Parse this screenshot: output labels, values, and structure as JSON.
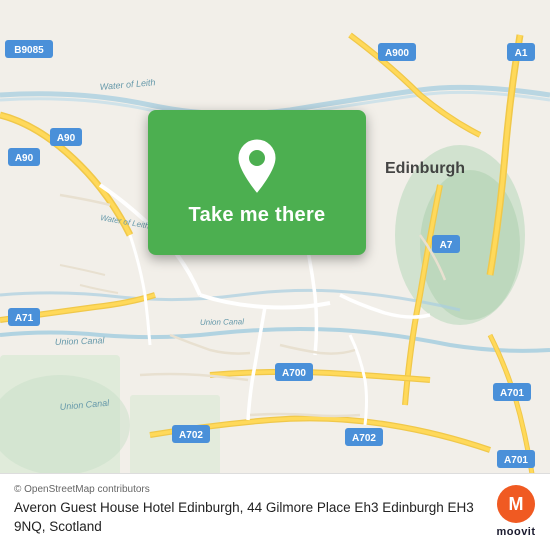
{
  "map": {
    "background_color": "#f2efe9",
    "road_color": "#ffffff",
    "major_road_color": "#f7c948",
    "minor_road_color": "#ddd"
  },
  "card": {
    "button_label": "Take me there",
    "background_color": "#4caf50",
    "pin_icon": "location-pin"
  },
  "info_bar": {
    "osm_credit": "© OpenStreetMap contributors",
    "address": "Averon Guest House Hotel Edinburgh, 44 Gilmore Place Eh3 Edinburgh EH3 9NQ, Scotland",
    "logo_text": "moovit"
  }
}
